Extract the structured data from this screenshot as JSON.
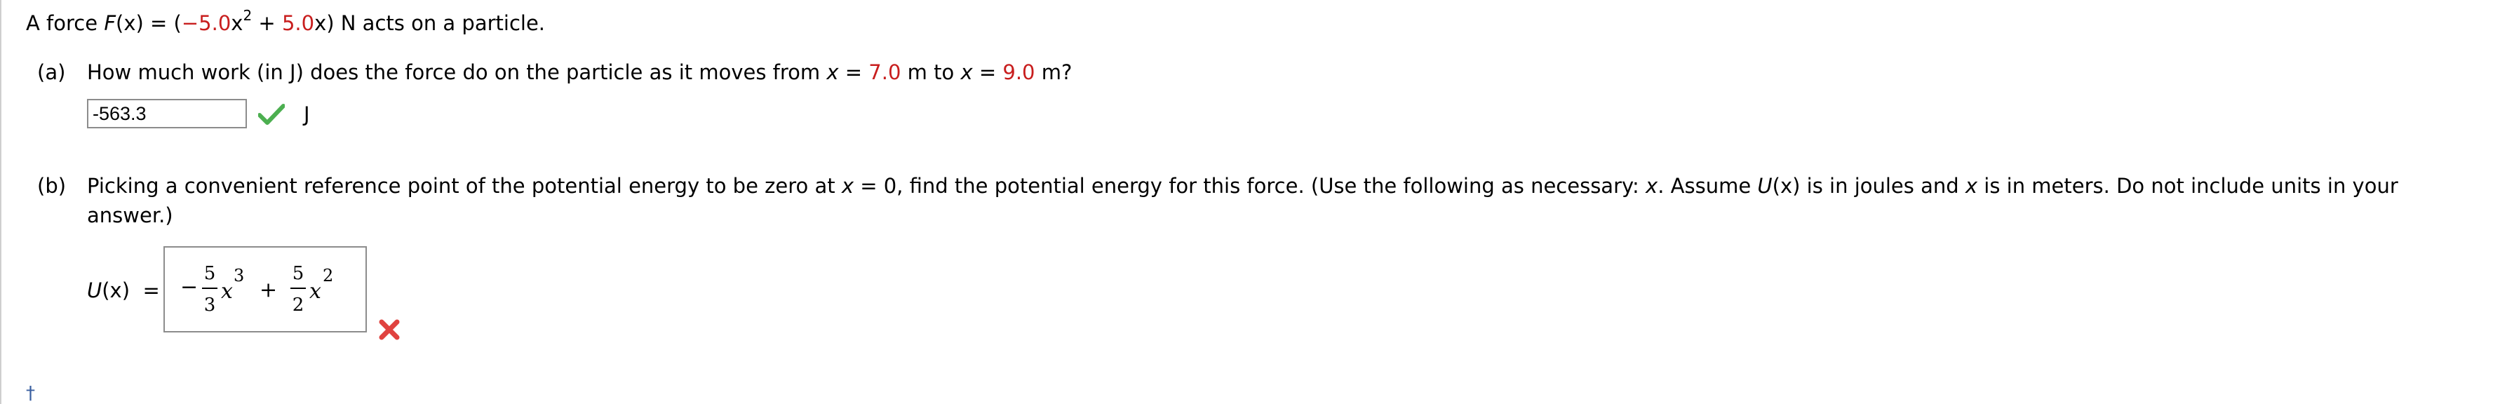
{
  "statement": {
    "prefix": "A force ",
    "func": "F",
    "paren_x": "(x)",
    "equals_open": " = (",
    "coef1": "−5.0",
    "x1": "x",
    "exp": "2",
    "plus": " + ",
    "coef2": "5.0",
    "x2": "x",
    "suffix": ") N acts on a particle."
  },
  "part_a": {
    "label": "(a)",
    "q_prefix": "How much work (in J) does the force do on the particle as it moves from ",
    "x_var1": "x",
    "eq1": " = ",
    "x_from": "7.0",
    "mid": " m to ",
    "x_var2": "x",
    "eq2": " = ",
    "x_to": "9.0",
    "q_suffix": " m?",
    "answer_value": "-563.3",
    "unit": "J",
    "status_icon": "check-icon",
    "status_color": "#4caf50"
  },
  "part_b": {
    "label": "(b)",
    "q1_a": "Picking a convenient reference point of the potential energy to be zero at ",
    "q1_x": "x",
    "q1_b": " = 0, find the potential energy for this force. (Use the following as necessary: ",
    "q1_x2": "x",
    "q1_c": ". Assume ",
    "q1_u": "U",
    "q1_d": "(x) is in joules and ",
    "q1_x3": "x",
    "q1_e": " is in meters. Do not include units in your",
    "q2": "answer.)",
    "u_label_u": "U",
    "u_label_rest": "(x)  =",
    "expr": {
      "minus": "−",
      "num1": "5",
      "den1": "3",
      "var1": "x",
      "exp1": "3",
      "plus": "+",
      "num2": "5",
      "den2": "2",
      "var2": "x",
      "exp2": "2"
    },
    "status_icon": "cross-icon",
    "status_color": "#e0423f"
  },
  "footer": {
    "dagger": "†"
  }
}
